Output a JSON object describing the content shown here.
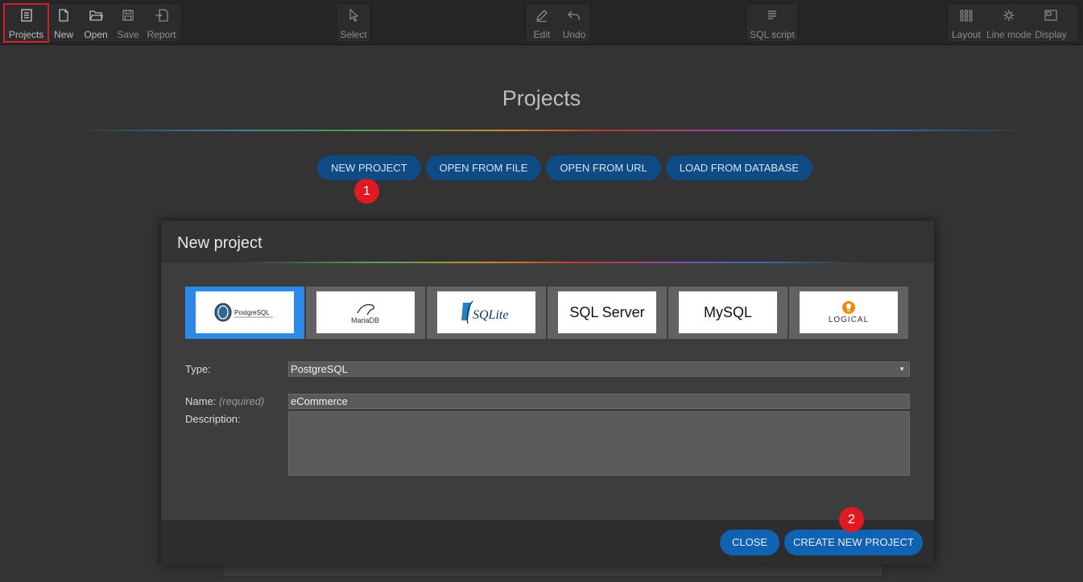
{
  "toolbar": {
    "projects": "Projects",
    "new": "New",
    "open": "Open",
    "save": "Save",
    "report": "Report",
    "select": "Select",
    "edit": "Edit",
    "undo": "Undo",
    "sql_script": "SQL script",
    "layout": "Layout",
    "line_mode": "Line mode",
    "display": "Display"
  },
  "page": {
    "title": "Projects",
    "buttons": {
      "new_project": "NEW PROJECT",
      "open_from_file": "OPEN FROM FILE",
      "open_from_url": "OPEN FROM URL",
      "load_from_database": "LOAD FROM DATABASE"
    },
    "markers": [
      "1",
      "2"
    ]
  },
  "modal": {
    "title": "New project",
    "db_types": [
      {
        "name": "PostgreSQL",
        "icon": "postgresql-logo"
      },
      {
        "name": "MariaDB",
        "icon": "mariadb-logo"
      },
      {
        "name": "SQLite",
        "icon": "sqlite-logo"
      },
      {
        "name": "SQL Server",
        "icon": "sql-server-text"
      },
      {
        "name": "MySQL",
        "icon": "mysql-text"
      },
      {
        "name": "LOGICAL",
        "icon": "lightbulb-logo"
      }
    ],
    "selected_db": "PostgreSQL",
    "type_label": "Type:",
    "type_value": "PostgreSQL",
    "name_label": "Name:",
    "name_hint": "(required)",
    "name_value": "eCommerce",
    "description_label": "Description:",
    "description_value": "",
    "close_label": "CLOSE",
    "create_label": "CREATE NEW PROJECT"
  },
  "colors": {
    "accent_button": "#0f63b2",
    "selected_tab": "#2b8ae6",
    "marker": "#e01a22",
    "highlight_outline": "#d0202a"
  }
}
